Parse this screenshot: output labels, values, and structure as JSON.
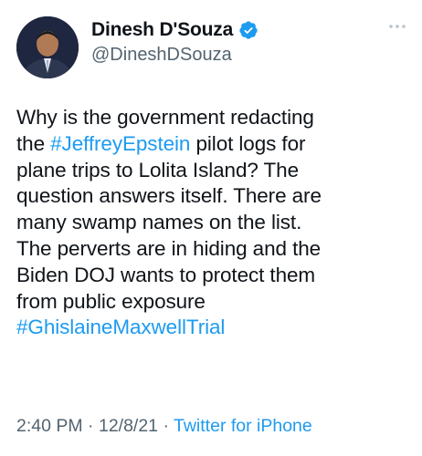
{
  "author": {
    "display_name": "Dinesh D'Souza",
    "handle": "@DineshDSouza",
    "verified": true
  },
  "tweet": {
    "lines": [
      [
        {
          "t": "Why is the government redacting",
          "tag": false
        }
      ],
      [
        {
          "t": "the ",
          "tag": false
        },
        {
          "t": "#JeffreyEpstein",
          "tag": true
        },
        {
          "t": " pilot logs for",
          "tag": false
        }
      ],
      [
        {
          "t": "plane trips to Lolita Island? The",
          "tag": false
        }
      ],
      [
        {
          "t": "question answers itself. There are",
          "tag": false
        }
      ],
      [
        {
          "t": "many swamp names on the list.",
          "tag": false
        }
      ],
      [
        {
          "t": "The perverts are in hiding and the",
          "tag": false
        }
      ],
      [
        {
          "t": "Biden DOJ wants to protect them",
          "tag": false
        }
      ],
      [
        {
          "t": "from public exposure",
          "tag": false
        }
      ],
      [
        {
          "t": "#GhislaineMaxwellTrial",
          "tag": true
        }
      ]
    ]
  },
  "meta": {
    "time": "2:40 PM",
    "date": "12/8/21",
    "separator": " · ",
    "source": "Twitter for iPhone"
  },
  "icons": {
    "verified": "verified-badge-icon",
    "more": "more-options-icon"
  },
  "colors": {
    "text": "#0f1419",
    "secondary": "#536471",
    "link": "#1d9bf0",
    "verified": "#1d9bf0"
  }
}
